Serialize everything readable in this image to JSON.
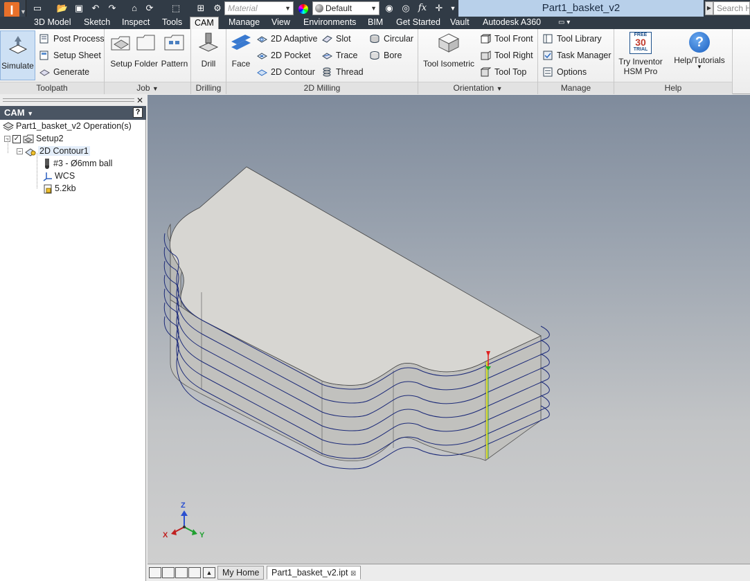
{
  "window": {
    "title": "Part1_basket_v2",
    "search_placeholder": "Search H"
  },
  "quick_access": {
    "material_placeholder": "Material",
    "appearance_value": "Default",
    "fx_label": "fx"
  },
  "tabs": [
    {
      "label": "3D Model"
    },
    {
      "label": "Sketch"
    },
    {
      "label": "Inspect"
    },
    {
      "label": "Tools"
    },
    {
      "label": "CAM"
    },
    {
      "label": "Manage"
    },
    {
      "label": "View"
    },
    {
      "label": "Environments"
    },
    {
      "label": "BIM"
    },
    {
      "label": "Get Started"
    },
    {
      "label": "Vault"
    },
    {
      "label": "Autodesk A360"
    }
  ],
  "ribbon": {
    "toolpath": {
      "label": "Toolpath",
      "simulate": "Simulate",
      "post_process": "Post Process",
      "setup_sheet": "Setup Sheet",
      "generate": "Generate"
    },
    "job": {
      "label": "Job",
      "setup": "Setup",
      "folder": "Folder",
      "pattern": "Pattern"
    },
    "drilling": {
      "label": "Drilling",
      "drill": "Drill"
    },
    "milling2d": {
      "label": "2D Milling",
      "face": "Face",
      "adaptive": "2D Adaptive",
      "pocket": "2D Pocket",
      "contour": "2D Contour",
      "slot": "Slot",
      "trace": "Trace",
      "thread": "Thread",
      "circular": "Circular",
      "bore": "Bore"
    },
    "orientation": {
      "label": "Orientation",
      "tool_isometric": "Tool Isometric",
      "tool_front": "Tool Front",
      "tool_right": "Tool Right",
      "tool_top": "Tool Top"
    },
    "manage": {
      "label": "Manage",
      "tool_library": "Tool Library",
      "task_manager": "Task Manager",
      "options": "Options"
    },
    "help": {
      "label": "Help",
      "try_line1": "Try Inventor",
      "try_line2": "HSM Pro",
      "help_tutorials": "Help/Tutorials",
      "free_badge_top": "FREE",
      "free_badge_num": "30",
      "free_badge_bottom": "TRIAL"
    }
  },
  "browser": {
    "header": "CAM",
    "help_glyph": "?",
    "tree": {
      "root": "Part1_basket_v2 Operation(s)",
      "setup": "Setup2",
      "operation": "2D Contour1",
      "tool": "#3 - Ø6mm ball",
      "wcs": "WCS",
      "nc_size": "5.2kb"
    }
  },
  "triad": {
    "x": "X",
    "y": "Y",
    "z": "Z"
  },
  "bottom_tabs": [
    {
      "label": "My Home"
    },
    {
      "label": "Part1_basket_v2.ipt"
    }
  ],
  "colors": {
    "title_bar": "#313b46",
    "document_title_bg": "#b8d0ea",
    "browser_header": "#4a5563",
    "toolpath": "#1c2a78"
  }
}
